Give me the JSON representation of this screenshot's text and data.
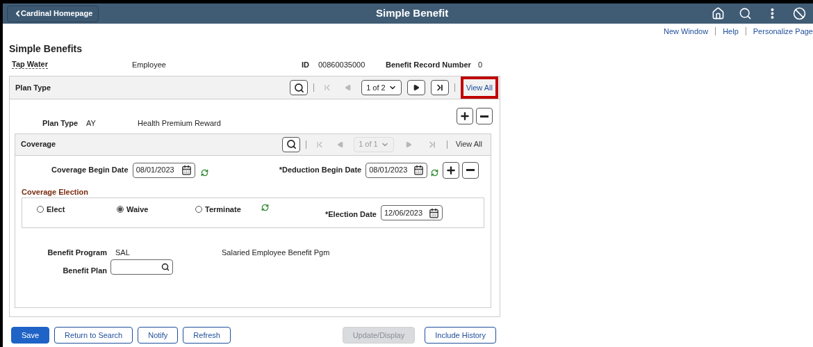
{
  "header": {
    "back_button": "Cardinal Homepage",
    "title": "Simple Benefit"
  },
  "top_links": [
    "New Window",
    "Help",
    "Personalize Page"
  ],
  "page_title": "Simple Benefits",
  "employee": {
    "name": "Tap Water",
    "role": "Employee",
    "id_label": "ID",
    "id": "00860035000",
    "record_label": "Benefit Record Number",
    "record": "0"
  },
  "plan_panel": {
    "title": "Plan Type",
    "pager": {
      "value": "1 of 2",
      "disabled": false
    },
    "view_all": {
      "label": "View All",
      "highlighted": true
    },
    "plan_type": {
      "label": "Plan Type",
      "code": "AY",
      "description": "Health Premium Reward"
    },
    "coverage": {
      "title": "Coverage",
      "pager": {
        "value": "1 of 1",
        "disabled": true
      },
      "view_all": {
        "label": "View All",
        "highlighted": false
      },
      "begin_date": {
        "label": "Coverage Begin Date",
        "value": "08/01/2023"
      },
      "deduction_date": {
        "label": "*Deduction Begin Date",
        "value": "08/01/2023"
      },
      "election_title": "Coverage Election",
      "options": [
        {
          "label": "Elect",
          "selected": false
        },
        {
          "label": "Waive",
          "selected": true
        },
        {
          "label": "Terminate",
          "selected": false
        }
      ],
      "election_date": {
        "label": "*Election Date",
        "value": "12/06/2023"
      },
      "program": {
        "label": "Benefit Program",
        "code": "SAL",
        "description": "Salaried Employee Benefit Pgm"
      },
      "plan": {
        "label": "Benefit Plan"
      }
    }
  },
  "buttons": [
    {
      "label": "Save",
      "kind": "primary"
    },
    {
      "label": "Return to Search",
      "kind": "secondary"
    },
    {
      "label": "Notify",
      "kind": "secondary"
    },
    {
      "label": "Refresh",
      "kind": "secondary"
    },
    {
      "label": "Update/Display",
      "kind": "disabled"
    },
    {
      "label": "Include History",
      "kind": "secondary"
    }
  ]
}
